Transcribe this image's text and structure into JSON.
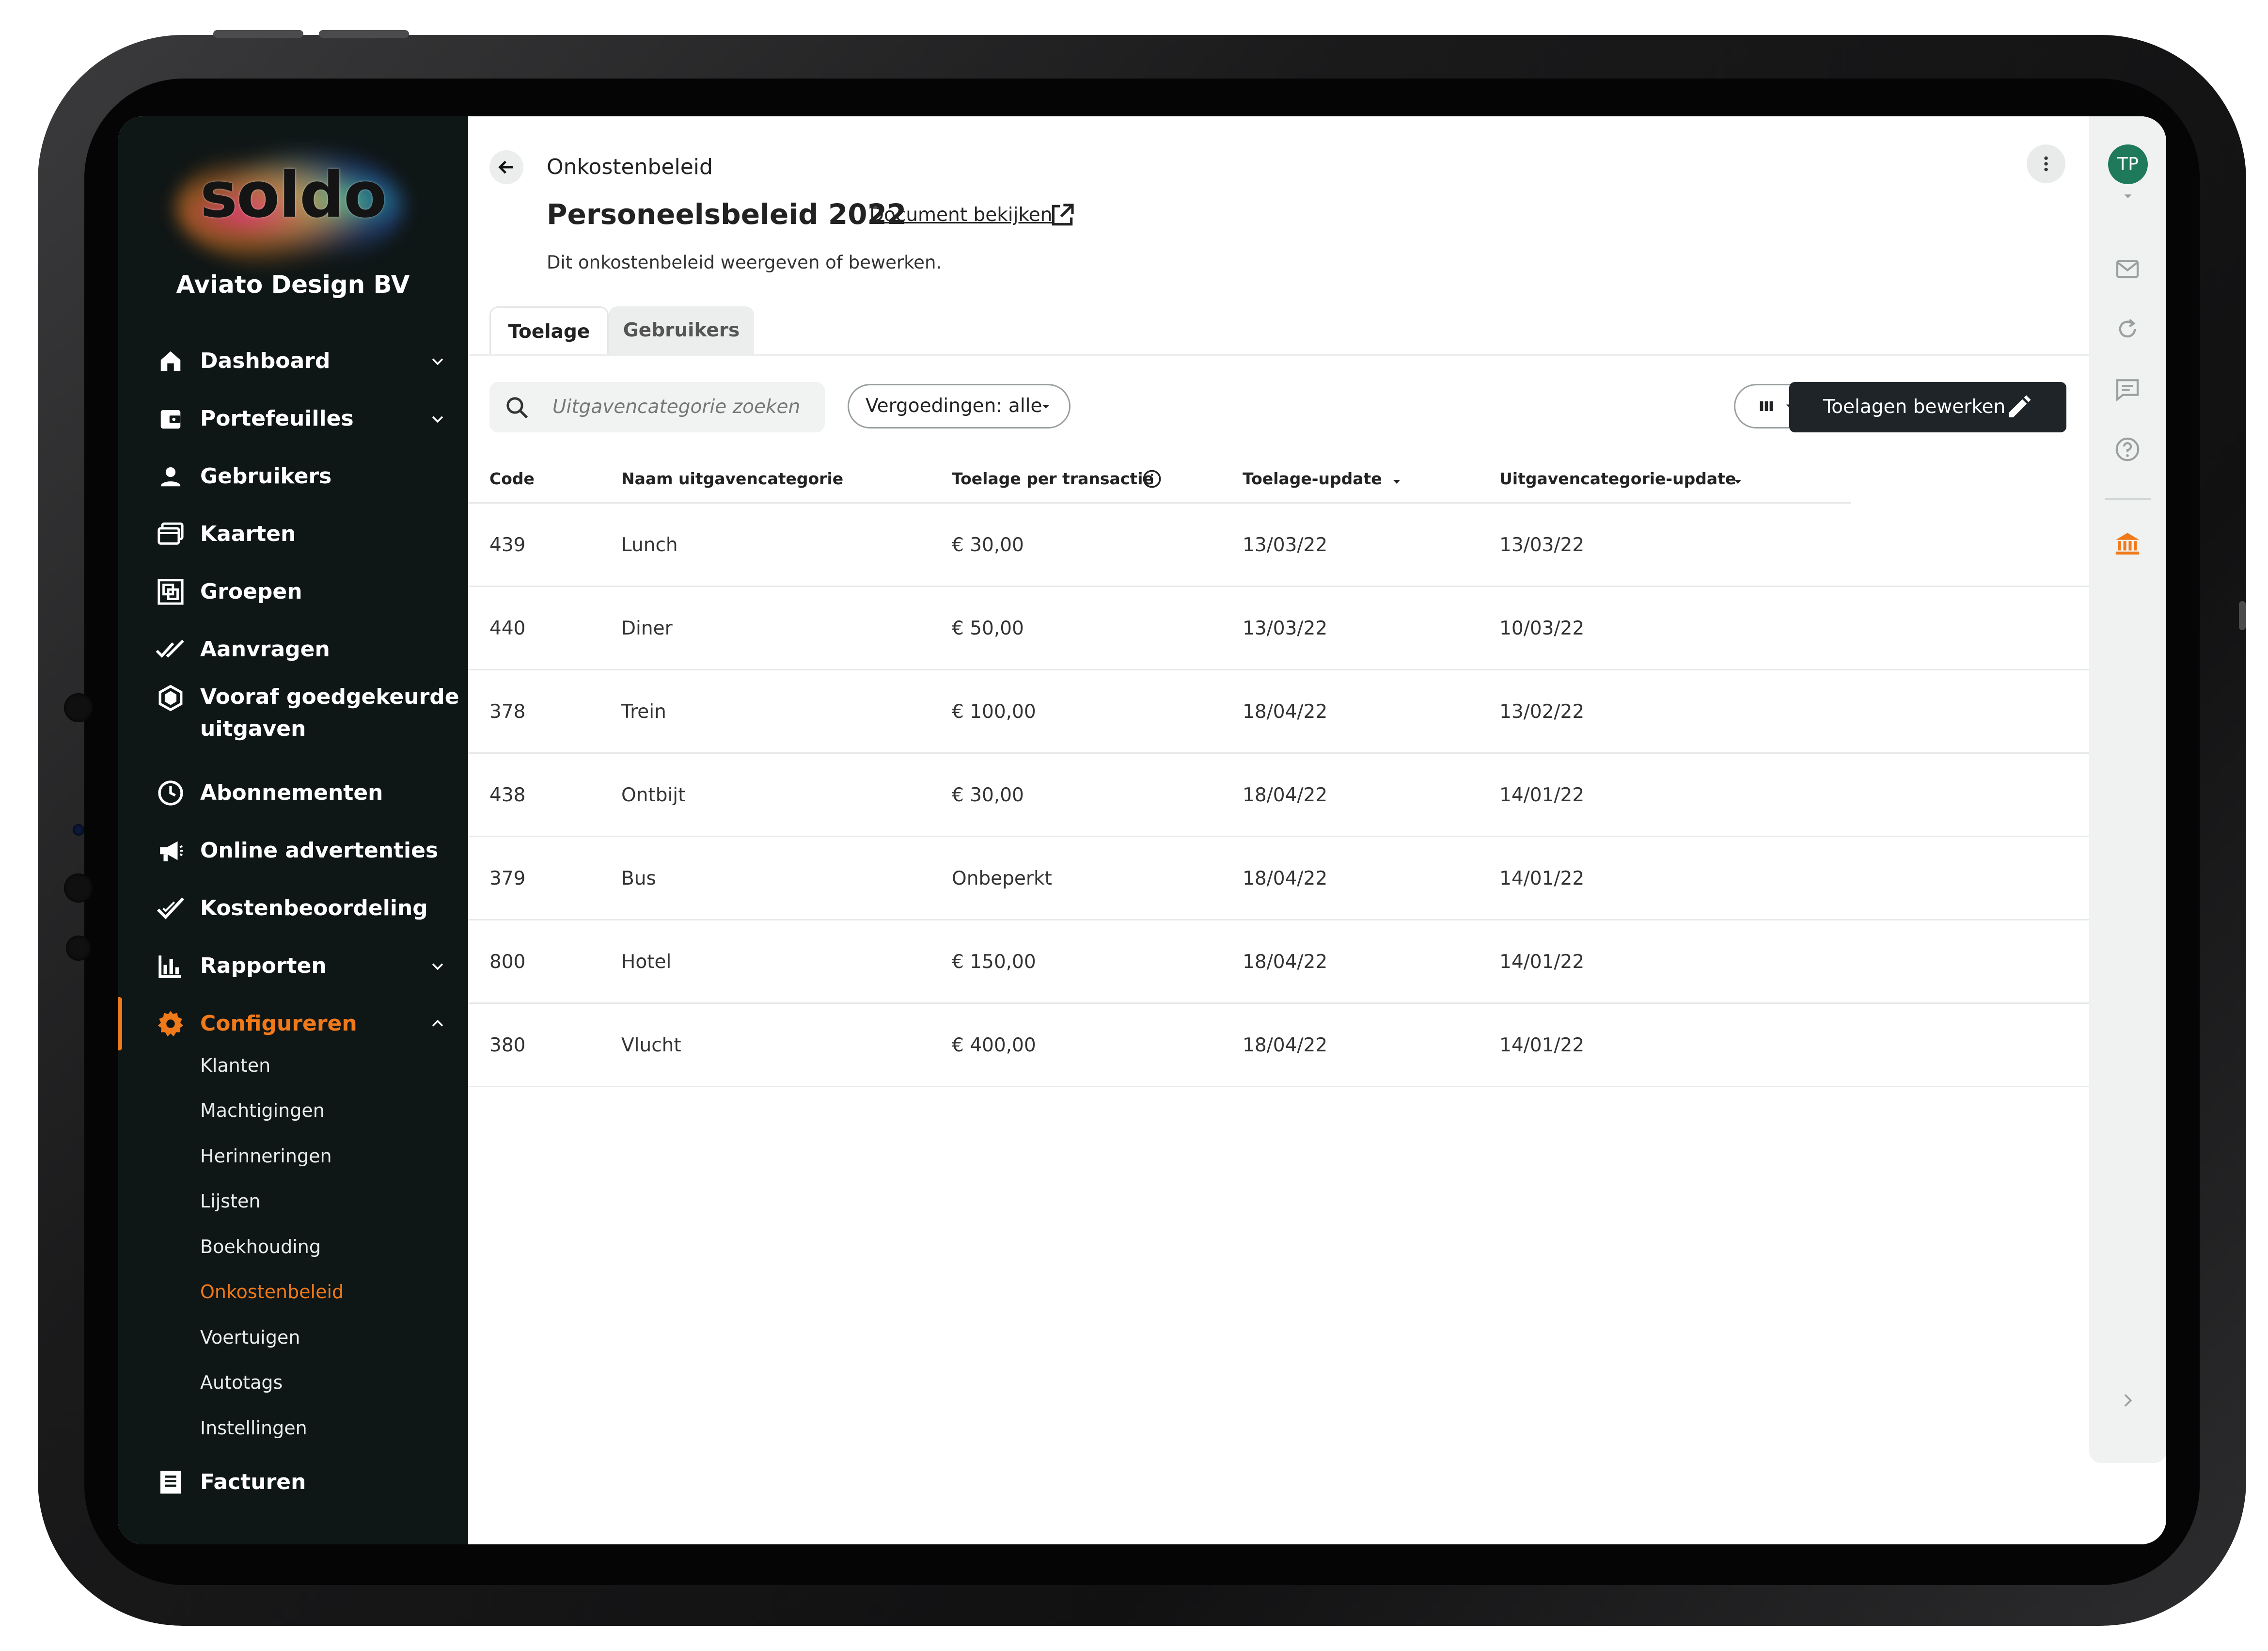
{
  "sidebar": {
    "logo_text": "soldo",
    "org_name": "Aviato Design BV",
    "items": [
      {
        "label": "Dashboard",
        "icon": "home-icon",
        "has_chevron": true
      },
      {
        "label": "Portefeuilles",
        "icon": "wallet-icon",
        "has_chevron": true
      },
      {
        "label": "Gebruikers",
        "icon": "user-icon",
        "has_chevron": false
      },
      {
        "label": "Kaarten",
        "icon": "cards-icon",
        "has_chevron": false
      },
      {
        "label": "Groepen",
        "icon": "groups-icon",
        "has_chevron": false
      },
      {
        "label": "Aanvragen",
        "icon": "double-check-icon",
        "has_chevron": false
      },
      {
        "label": "Vooraf goedgekeurde",
        "label2": "uitgaven",
        "icon": "shield-icon",
        "has_chevron": false
      },
      {
        "label": "Abonnementen",
        "icon": "clock-icon",
        "has_chevron": false
      },
      {
        "label": "Online advertenties",
        "icon": "megaphone-icon",
        "has_chevron": false
      },
      {
        "label": "Kostenbeoordeling",
        "icon": "check-icon",
        "has_chevron": false
      },
      {
        "label": "Rapporten",
        "icon": "bar-chart-icon",
        "has_chevron": true
      },
      {
        "label": "Configureren",
        "icon": "gear-icon",
        "has_chevron": true,
        "active": true
      }
    ],
    "sub_items": [
      "Klanten",
      "Machtigingen",
      "Herinneringen",
      "Lijsten",
      "Boekhouding",
      "Onkostenbeleid",
      "Voertuigen",
      "Autotags",
      "Instellingen"
    ],
    "active_sub": "Onkostenbeleid",
    "footer_item": {
      "label": "Facturen",
      "icon": "invoice-icon"
    },
    "accent_color": "#f07a1a",
    "background_color": "#0f1616"
  },
  "header": {
    "breadcrumb": "Onkostenbeleid",
    "title": "Personeelsbeleid 2022",
    "doc_link": "Document bekijken",
    "subtitle": "Dit onkostenbeleid weergeven of bewerken."
  },
  "tabs": [
    {
      "label": "Toelage",
      "selected": true
    },
    {
      "label": "Gebruikers",
      "selected": false
    }
  ],
  "toolbar": {
    "search_placeholder": "Uitgavencategorie zoeken",
    "filter_label": "Vergoedingen: alle",
    "edit_button_label": "Toelagen bewerken"
  },
  "table": {
    "columns": [
      "Code",
      "Naam uitgavencategorie",
      "Toelage per transactie",
      "Toelage-update",
      "Uitgavencategorie-update"
    ],
    "rows": [
      [
        "439",
        "Lunch",
        "€ 30,00",
        "13/03/22",
        "13/03/22"
      ],
      [
        "440",
        "Diner",
        "€ 50,00",
        "13/03/22",
        "10/03/22"
      ],
      [
        "378",
        "Trein",
        "€ 100,00",
        "18/04/22",
        "13/02/22"
      ],
      [
        "438",
        "Ontbijt",
        "€ 30,00",
        "18/04/22",
        "14/01/22"
      ],
      [
        "379",
        "Bus",
        "Onbeperkt",
        "18/04/22",
        "14/01/22"
      ],
      [
        "800",
        "Hotel",
        "€ 150,00",
        "18/04/22",
        "14/01/22"
      ],
      [
        "380",
        "Vlucht",
        "€ 400,00",
        "18/04/22",
        "14/01/22"
      ]
    ]
  },
  "rail": {
    "avatar_initials": "TP",
    "avatar_color": "#1f7a5c",
    "icons": [
      "mail-icon",
      "refresh-icon",
      "chat-icon",
      "help-icon",
      "bank-icon"
    ]
  },
  "primary_button_color": "#1e2428"
}
